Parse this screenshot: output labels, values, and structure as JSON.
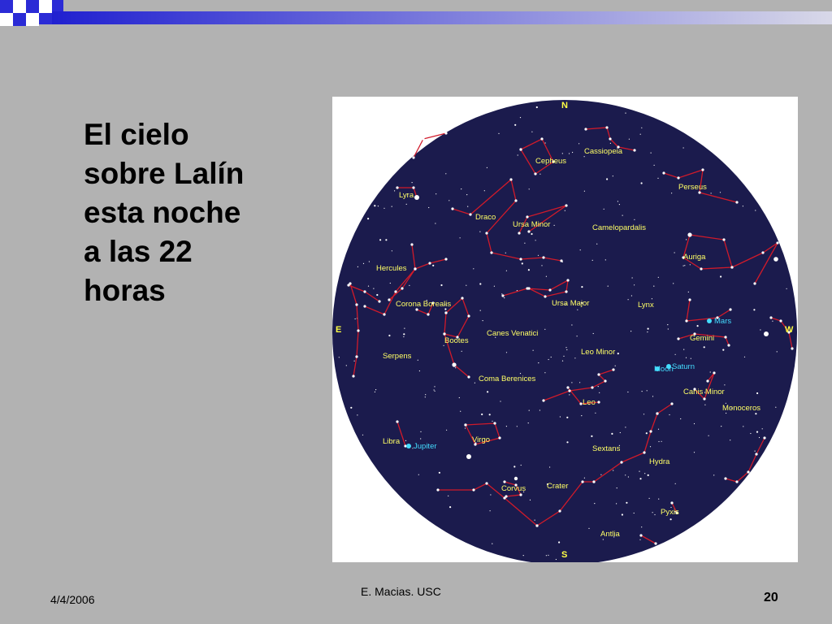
{
  "slide": {
    "title": "El cielo\nsobre Lalín\nesta noche\na las 22\nhoras",
    "date": "4/4/2006",
    "author": "E. Macias. USC",
    "page_number": "20"
  },
  "colors": {
    "background": "#b2b2b2",
    "sky": "#1b1b4d",
    "constellation_lines": "#d01a2a",
    "labels": "#ffff66",
    "planets": "#44ddff",
    "accent_blue": "#2b2bd6"
  },
  "sky_map": {
    "directions": {
      "north": "N",
      "south": "S",
      "east": "E",
      "west": "W"
    },
    "constellations": [
      "Cassiopeia",
      "Cepheus",
      "Lyra",
      "Draco",
      "Ursa Minor",
      "Perseus",
      "Camelopardalis",
      "Auriga",
      "Hercules",
      "Corona Borealis",
      "Ursa Major",
      "Lynx",
      "Bootes",
      "Canes Venatici",
      "Gemini",
      "Serpens",
      "Leo Minor",
      "Coma Berenices",
      "Canis Minor",
      "Leo",
      "Monoceros",
      "Libra",
      "Virgo",
      "Sextans",
      "Hydra",
      "Corvus",
      "Crater",
      "Pyxis",
      "Antlia"
    ],
    "planets": [
      "Mars",
      "Saturn",
      "Jupiter",
      "Moon"
    ]
  }
}
